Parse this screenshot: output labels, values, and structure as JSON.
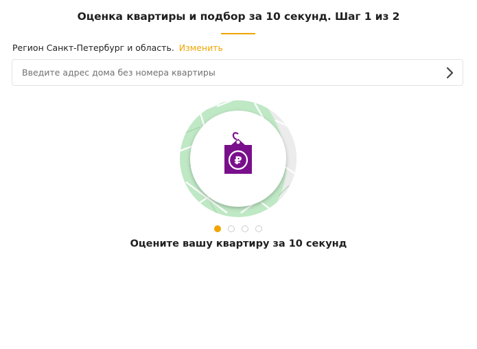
{
  "header": {
    "title": "Оценка квартиры и подбор за 10 секунд. Шаг 1 из 2"
  },
  "region": {
    "text": "Регион Санкт-Петербург и область.",
    "change_link": "Изменить"
  },
  "address": {
    "placeholder": "Введите адрес дома без номера квартиры",
    "value": ""
  },
  "slider": {
    "caption": "Оцените вашу квартиру за 10 секунд",
    "current_slide": 1,
    "total_slides": 4,
    "icon": "ruble-price-tag-icon"
  },
  "colors": {
    "accent": "#f0a500",
    "tag_purple": "#7a0f8c",
    "map_green": "#bfe8c5"
  }
}
